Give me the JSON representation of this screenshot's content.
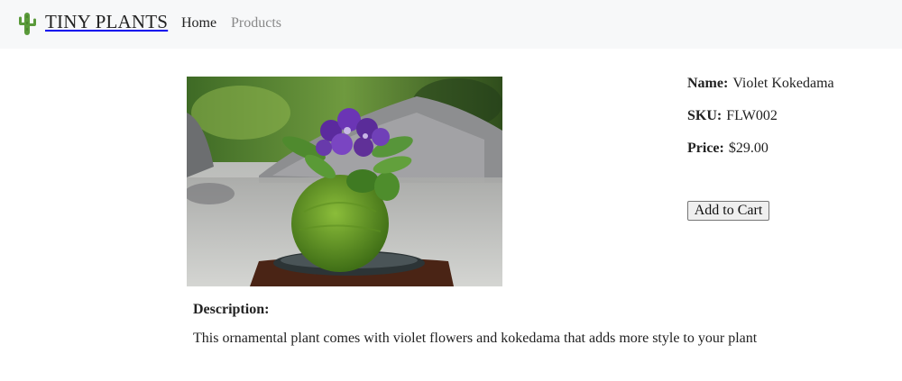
{
  "navbar": {
    "brand_icon": "cactus-icon",
    "brand_name": "TINY PLANTS",
    "links": [
      {
        "label": "Home",
        "active": true
      },
      {
        "label": "Products",
        "active": false
      }
    ]
  },
  "product": {
    "image_subject": "violet-kokedama-photo",
    "name_label": "Name:",
    "name": "Violet Kokedama",
    "sku_label": "SKU:",
    "sku": "FLW002",
    "price_label": "Price:",
    "price": "$29.00",
    "add_to_cart_label": "Add to Cart",
    "description_label": "Description:",
    "description": "This ornamental plant comes with violet flowers and kokedama that adds more style to your plant"
  },
  "colors": {
    "navbar_bg": "#f7f8f9",
    "cactus_green": "#5a9a3a",
    "inactive_link": "#888888"
  }
}
